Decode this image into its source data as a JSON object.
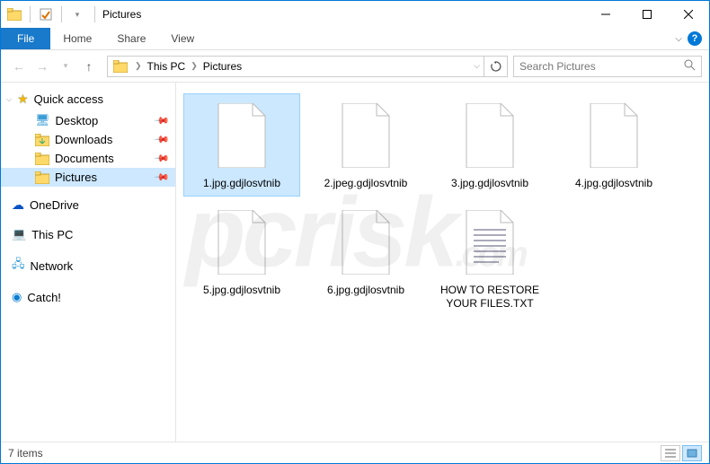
{
  "window": {
    "title": "Pictures"
  },
  "ribbon": {
    "file": "File",
    "tabs": [
      "Home",
      "Share",
      "View"
    ]
  },
  "breadcrumb": {
    "segments": [
      "This PC",
      "Pictures"
    ]
  },
  "search": {
    "placeholder": "Search Pictures"
  },
  "sidebar": {
    "quick_access": "Quick access",
    "pinned": [
      {
        "label": "Desktop",
        "icon": "desktop"
      },
      {
        "label": "Downloads",
        "icon": "folder"
      },
      {
        "label": "Documents",
        "icon": "folder"
      },
      {
        "label": "Pictures",
        "icon": "folder",
        "selected": true
      }
    ],
    "roots": [
      {
        "label": "OneDrive",
        "icon": "cloud"
      },
      {
        "label": "This PC",
        "icon": "pc"
      },
      {
        "label": "Network",
        "icon": "network"
      },
      {
        "label": "Catch!",
        "icon": "catch"
      }
    ]
  },
  "files": [
    {
      "name": "1.jpg.gdjlosvtnib",
      "type": "blank",
      "selected": true
    },
    {
      "name": "2.jpeg.gdjlosvtnib",
      "type": "blank"
    },
    {
      "name": "3.jpg.gdjlosvtnib",
      "type": "blank"
    },
    {
      "name": "4.jpg.gdjlosvtnib",
      "type": "blank"
    },
    {
      "name": "5.jpg.gdjlosvtnib",
      "type": "blank"
    },
    {
      "name": "6.jpg.gdjlosvtnib",
      "type": "blank"
    },
    {
      "name": "HOW TO RESTORE YOUR FILES.TXT",
      "type": "text"
    }
  ],
  "status": {
    "count_label": "7 items"
  },
  "watermark": "pcrisk.com",
  "icons": {
    "folder_svg": "folder",
    "file_blank_svg": "file-blank",
    "file_text_svg": "file-text"
  }
}
